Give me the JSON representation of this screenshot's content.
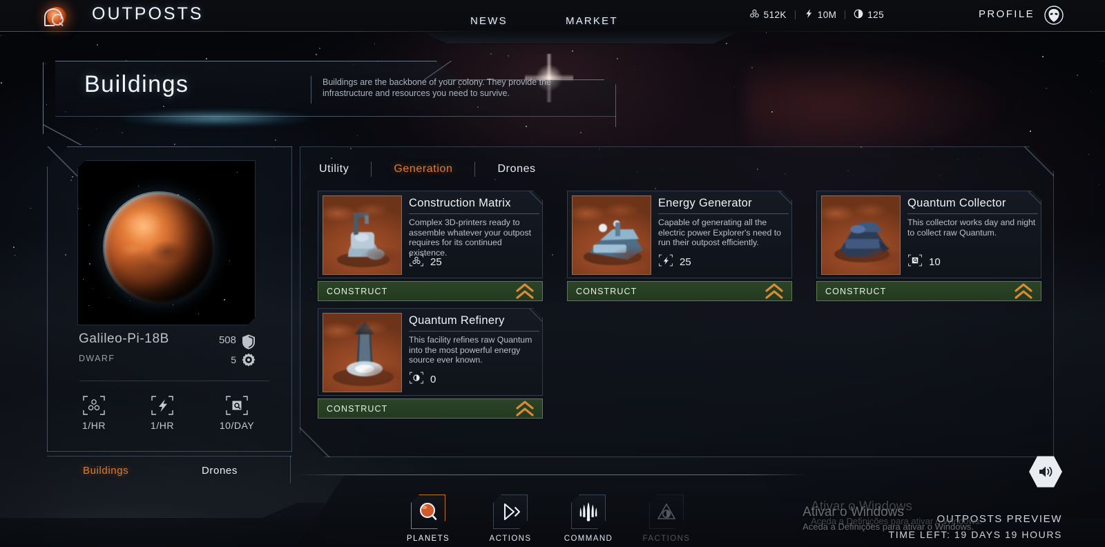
{
  "topbar": {
    "brand": "OUTPOSTS",
    "logo_icon": "outposts-logo-icon",
    "nav": [
      {
        "label": "NEWS",
        "name": "nav-news"
      },
      {
        "label": "MARKET",
        "name": "nav-market"
      }
    ],
    "stats": [
      {
        "icon": "minerals-icon",
        "value": "512K"
      },
      {
        "icon": "energy-icon",
        "value": "10M"
      },
      {
        "icon": "quantum-icon",
        "value": "125"
      }
    ],
    "profile_label": "PROFILE",
    "avatar_icon": "alien-avatar-icon"
  },
  "heading": {
    "title": "Buildings",
    "subtitle": "Buildings are the backbone of your colony. They provide the infrastructure and resources you need to survive."
  },
  "planet_panel": {
    "image_alt": "planet-galileo-pi-18b",
    "name": "Galileo-Pi-18B",
    "type": "DWARF",
    "shield_value": "508",
    "shield_icon": "shield-icon",
    "gear_value": "5",
    "gear_icon": "gear-icon",
    "rates": [
      {
        "icon": "minerals-icon",
        "label": "1/HR"
      },
      {
        "icon": "energy-icon",
        "label": "1/HR"
      },
      {
        "icon": "quantum-icon",
        "label": "10/DAY"
      }
    ],
    "tabs": [
      {
        "label": "Buildings",
        "active": true
      },
      {
        "label": "Drones",
        "active": false
      }
    ]
  },
  "main_panel": {
    "tabs": [
      {
        "label": "Utility",
        "active": false
      },
      {
        "label": "Generation",
        "active": true
      },
      {
        "label": "Drones",
        "active": false
      }
    ],
    "construct_label": "CONSTRUCT",
    "cards": [
      {
        "title": "Construction Matrix",
        "desc": "Complex 3D-printers ready to assemble whatever your outpost requires for its continued existence.",
        "cost_icon": "minerals-icon",
        "cost_value": "25",
        "thumb": "construction-matrix-thumb"
      },
      {
        "title": "Energy Generator",
        "desc": "Capable of generating all the electric power Explorer's need to run their outpost efficiently.",
        "cost_icon": "energy-icon",
        "cost_value": "25",
        "thumb": "energy-generator-thumb"
      },
      {
        "title": "Quantum Collector",
        "desc": "This collector works day and night to collect raw Quantum.",
        "cost_icon": "quantum-icon",
        "cost_value": "10",
        "thumb": "quantum-collector-thumb"
      },
      {
        "title": "Quantum Refinery",
        "desc": "This facility refines raw Quantum into the most powerful energy source ever known.",
        "cost_icon": "refined-quantum-icon",
        "cost_value": "0",
        "thumb": "quantum-refinery-thumb"
      }
    ]
  },
  "bottom_nav": [
    {
      "label": "PLANETS",
      "icon": "planet-search-icon",
      "state": "active"
    },
    {
      "label": "ACTIONS",
      "icon": "play-chevron-icon",
      "state": "normal"
    },
    {
      "label": "COMMAND",
      "icon": "command-crest-icon",
      "state": "normal"
    },
    {
      "label": "FACTIONS",
      "icon": "factions-icon",
      "state": "disabled"
    }
  ],
  "footer": {
    "sound_icon": "sound-on-icon",
    "preview_title": "OUTPOSTS PREVIEW",
    "time_left": "TIME LEFT: 19 DAYS 19 HOURS"
  },
  "watermark": {
    "line1": "Ativar o Windows",
    "line2": "Aceda a Definições para ativar o Windows."
  },
  "colors": {
    "accent_orange": "#e07a2e",
    "construct_green": "#2b4427",
    "panel_border": "#96aac6",
    "text_primary": "#eef3f9"
  }
}
